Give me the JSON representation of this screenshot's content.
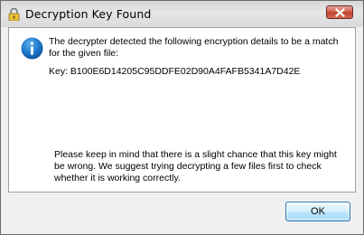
{
  "window": {
    "title": "Decryption Key Found"
  },
  "icons": {
    "app": "lock-icon",
    "close": "close-icon",
    "message": "info-icon"
  },
  "message": {
    "detection": "The decrypter detected the following encryption details to be a match for the given file:",
    "key_line": "Key: B100E6D14205C95DDFE02D90A4FAFB5341A7D42E",
    "warning": "Please keep in mind that there is a slight chance that this key might be wrong. We suggest trying decrypting a few files first to check whether it is working correctly."
  },
  "buttons": {
    "ok": "OK"
  },
  "colors": {
    "close_button": "#c94a35",
    "info_icon": "#1b74c7",
    "ok_border": "#3c7fb1",
    "content_background": "#ffffff",
    "chrome_background": "#f0f0f0"
  }
}
